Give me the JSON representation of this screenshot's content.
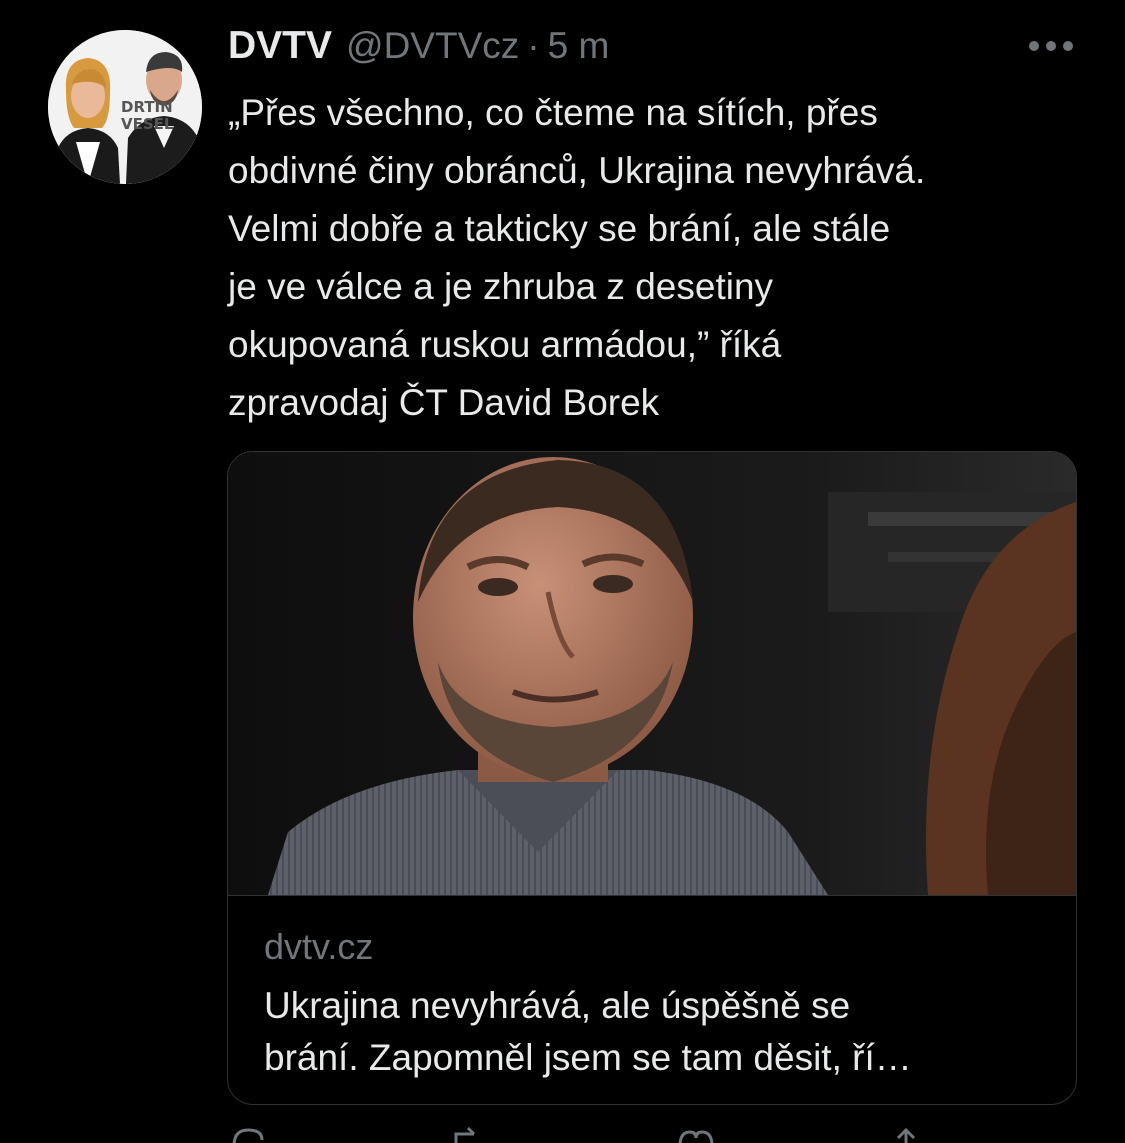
{
  "tweet": {
    "author_name": "DVTV",
    "author_handle": "@DVTVcz",
    "separator": "·",
    "time": "5 m",
    "text": "„Přes všechno, co čteme na sítích, přes\nobdivné činy obránců, Ukrajina nevyhrává.\nVelmi dobře a takticky se brání, ale stále\nje ve válce a je zhruba z desetiny\nokupovaná ruskou armádou,” říká\nzpravodaj ČT David Borek"
  },
  "avatar": {
    "logo_line1": "DRTIN",
    "logo_line2": "VESEL"
  },
  "card": {
    "domain": "dvtv.cz",
    "title": "Ukrajina nevyhrává, ale úspěšně se\nbrání. Zapomněl jsem se tam děsit, ří…"
  },
  "icons": {
    "more": "more-horizontal-icon",
    "reply": "reply-icon",
    "retweet": "retweet-icon",
    "like": "heart-icon",
    "share": "share-icon"
  },
  "colors": {
    "background": "#000000",
    "primary_text": "#e7e9ea",
    "secondary_text": "#71767b",
    "border": "#2f3336"
  }
}
